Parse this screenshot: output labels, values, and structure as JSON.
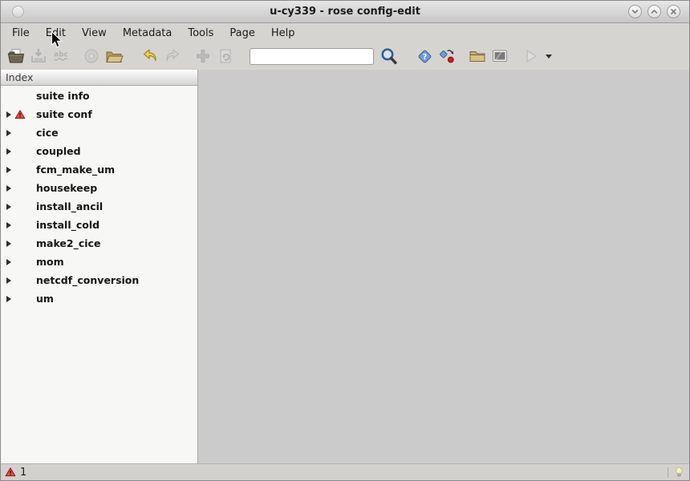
{
  "window": {
    "title": "u-cy339 - rose config-edit",
    "controls": [
      "chevron-down-icon",
      "chevron-up-icon",
      "close-icon"
    ]
  },
  "menu": {
    "items": [
      "File",
      "Edit",
      "View",
      "Metadata",
      "Tools",
      "Page",
      "Help"
    ]
  },
  "toolbar": {
    "icons": [
      "open",
      "save",
      "check-document",
      "load-metadata",
      "browse-files",
      "undo",
      "redo",
      "add",
      "revert-page",
      "find",
      "validate-metadata",
      "transform-macro",
      "browse-suite",
      "view-output",
      "run-suite",
      "run-suite-options"
    ],
    "disabled_icons": [
      "save",
      "check-document",
      "load-metadata",
      "redo",
      "add",
      "revert-page",
      "run-suite"
    ],
    "search": {
      "value": "",
      "placeholder": ""
    }
  },
  "sidebar": {
    "header": "Index",
    "items": [
      {
        "label": "suite info",
        "expandable": false,
        "warning": false
      },
      {
        "label": "suite conf",
        "expandable": true,
        "warning": true
      },
      {
        "label": "cice",
        "expandable": true,
        "warning": false
      },
      {
        "label": "coupled",
        "expandable": true,
        "warning": false
      },
      {
        "label": "fcm_make_um",
        "expandable": true,
        "warning": false
      },
      {
        "label": "housekeep",
        "expandable": true,
        "warning": false
      },
      {
        "label": "install_ancil",
        "expandable": true,
        "warning": false
      },
      {
        "label": "install_cold",
        "expandable": true,
        "warning": false
      },
      {
        "label": "make2_cice",
        "expandable": true,
        "warning": false
      },
      {
        "label": "mom",
        "expandable": true,
        "warning": false
      },
      {
        "label": "netcdf_conversion",
        "expandable": true,
        "warning": false
      },
      {
        "label": "um",
        "expandable": true,
        "warning": false
      }
    ]
  },
  "statusbar": {
    "error_count": "1",
    "icons": [
      "warning-icon",
      "bulb-icon"
    ]
  },
  "colors": {
    "chrome_bg": "#d6d4d1",
    "main_bg": "#cbcbcb",
    "sidebar_bg": "#f7f7f6",
    "warning_red": "#dd5448",
    "undo_yellow": "#ead34f",
    "validate_blue": "#6d9ed6"
  }
}
